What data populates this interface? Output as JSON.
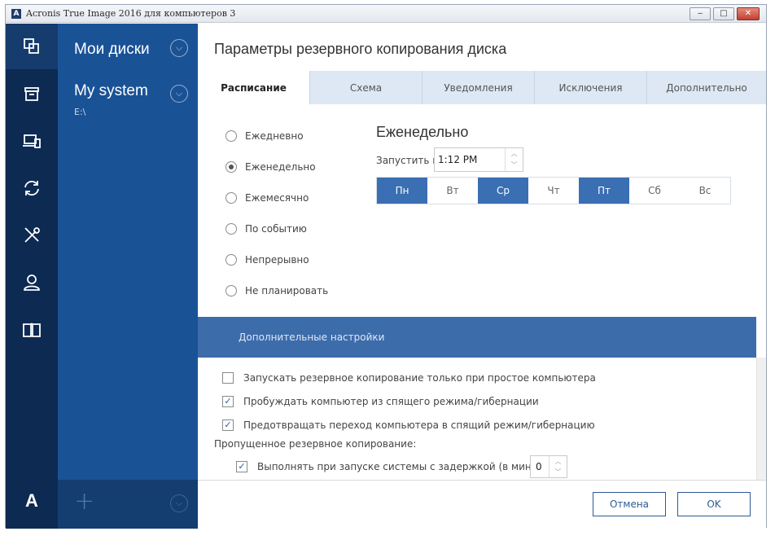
{
  "window": {
    "title": "Acronis True Image 2016 для компьютеров 3",
    "logo": "A",
    "min_label": "‒",
    "max_label": "□",
    "close_label": "✕"
  },
  "rail": {
    "items": [
      {
        "icon": "copy-icon"
      },
      {
        "icon": "archive-icon"
      },
      {
        "icon": "devices-icon"
      },
      {
        "icon": "sync-icon"
      },
      {
        "icon": "tools-icon"
      },
      {
        "icon": "account-icon"
      },
      {
        "icon": "book-icon"
      }
    ],
    "logo": "A"
  },
  "sidebar": {
    "header": "Мои диски",
    "selected": {
      "title": "My system",
      "subtitle": "E:\\"
    },
    "add_label": "+"
  },
  "main": {
    "title": "Параметры резервного копирования диска",
    "tabs": [
      {
        "label": "Расписание",
        "active": true
      },
      {
        "label": "Схема"
      },
      {
        "label": "Уведомления"
      },
      {
        "label": "Исключения"
      },
      {
        "label": "Дополнительно"
      }
    ],
    "schedule_options": [
      {
        "label": "Ежедневно",
        "checked": false
      },
      {
        "label": "Еженедельно",
        "checked": true
      },
      {
        "label": "Ежемесячно",
        "checked": false
      },
      {
        "label": "По событию",
        "checked": false
      },
      {
        "label": "Непрерывно",
        "checked": false
      },
      {
        "label": "Не планировать",
        "checked": false
      }
    ],
    "weekly": {
      "title": "Еженедельно",
      "start_label": "Запустить в",
      "time": "1:12 PM",
      "days": [
        {
          "label": "Пн",
          "on": true
        },
        {
          "label": "Вт",
          "on": false
        },
        {
          "label": "Ср",
          "on": true
        },
        {
          "label": "Чт",
          "on": false
        },
        {
          "label": "Пт",
          "on": true
        },
        {
          "label": "Сб",
          "on": false
        },
        {
          "label": "Вс",
          "on": false
        }
      ]
    },
    "advanced": {
      "header": "Дополнительные настройки",
      "options": [
        {
          "label": "Запускать резервное копирование только при простое компьютера",
          "checked": false
        },
        {
          "label": "Пробуждать компьютер из спящего режима/гибернации",
          "checked": true
        },
        {
          "label": "Предотвращать переход компьютера в спящий режим/гибернацию",
          "checked": true
        }
      ],
      "missed_label": "Пропущенное резервное копирование:",
      "delay_option": {
        "label": "Выполнять при запуске системы с задержкой (в минутах):",
        "checked": true,
        "value": "0"
      }
    },
    "buttons": {
      "cancel": "Отмена",
      "ok": "OK"
    }
  },
  "colors": {
    "rail_bg": "#0c2a52",
    "sidebar_bg": "#1a5296",
    "accent": "#3a6fb3",
    "advanced_bar": "#3d6cab",
    "tabs_bg": "#dde8f4"
  }
}
